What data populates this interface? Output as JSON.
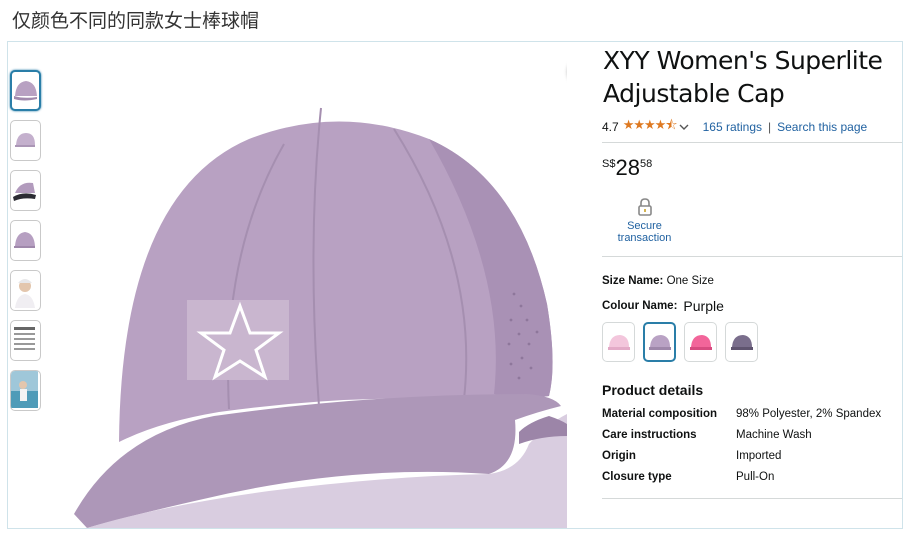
{
  "caption": "仅颜色不同的同款女士棒球帽",
  "product": {
    "title_line1": "XYY Women's Superlite",
    "title_line2": "Adjustable Cap",
    "rating_value": "4.7",
    "stars": "★★★★⯪",
    "ratings_count": "165 ratings",
    "separator": "|",
    "search_link": "Search this page",
    "price_currency": "S$",
    "price_whole": "28",
    "price_cents": "58",
    "secure_line1": "Secure",
    "secure_line2": "transaction",
    "size_label": "Size Name:",
    "size_value": "One Size",
    "colour_label": "Colour Name:",
    "colour_value": "Purple",
    "swatch_colors": [
      "#f3c6dc",
      "#b9a2c4",
      "#f2659a",
      "#7a6e8c"
    ],
    "details_title": "Product details",
    "details": [
      {
        "key": "Material composition",
        "value": "98% Polyester, 2% Spandex"
      },
      {
        "key": "Care instructions",
        "value": "Machine Wash"
      },
      {
        "key": "Origin",
        "value": "Imported"
      },
      {
        "key": "Closure type",
        "value": "Pull-On"
      }
    ]
  },
  "colors": {
    "cap_main": "#b8a1c2",
    "cap_shadow": "#9d86a9",
    "star_box": "#c9b6cf",
    "link": "#2162a1",
    "stars": "#de7921"
  }
}
